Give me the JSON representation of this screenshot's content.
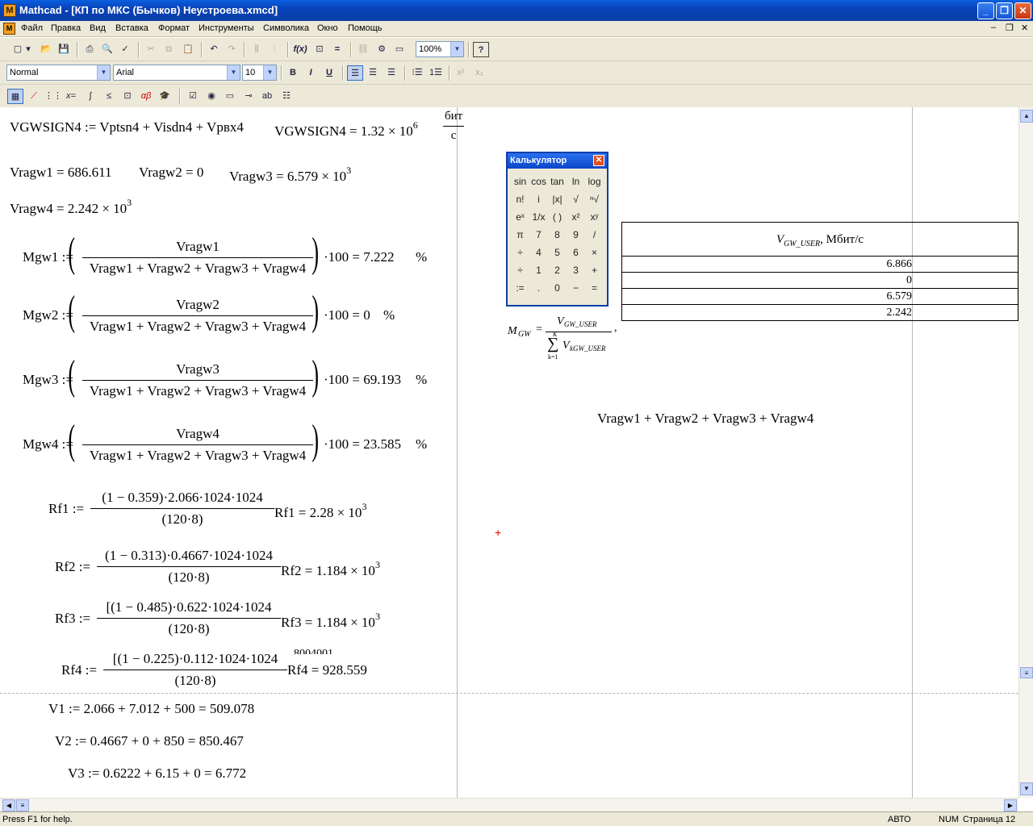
{
  "window": {
    "title": "Mathcad - [КП по МКС (Бычков) Неустроева.xmcd]"
  },
  "menu": [
    "Файл",
    "Правка",
    "Вид",
    "Вставка",
    "Формат",
    "Инструменты",
    "Символика",
    "Окно",
    "Помощь"
  ],
  "format_toolbar": {
    "style": "Normal",
    "font": "Arial",
    "size": "10",
    "zoom": "100%"
  },
  "doc": {
    "vgwsign": {
      "lhs": "VGWSIGN4 := Vptsn4 + Visdn4 + Vрвх4",
      "result": "VGWSIGN4 = 1.32 × 10",
      "exp": "6",
      "unit_num": "бит",
      "unit_den": "с"
    },
    "vrag_line1": {
      "a": "Vragw1 = 686.611",
      "b": "Vragw2 = 0",
      "c": "Vragw3 = 6.579 × 10",
      "c_exp": "3"
    },
    "vrag_line2": {
      "a": "Vragw4 = 2.242 × 10",
      "a_exp": "3"
    },
    "mgw": [
      {
        "lhs": "Mgw1 :=",
        "num": "Vragw1",
        "den": "Vragw1 + Vragw2 + Vragw3 + Vragw4",
        "res": "·100 = 7.222",
        "unit": "%"
      },
      {
        "lhs": "Mgw2 :=",
        "num": "Vragw2",
        "den": "Vragw1 + Vragw2 + Vragw3 + Vragw4",
        "res": "·100 = 0",
        "unit": "%"
      },
      {
        "lhs": "Mgw3 :=",
        "num": "Vragw3",
        "den": "Vragw1 + Vragw2 + Vragw3 + Vragw4",
        "res": "·100 = 69.193",
        "unit": "%"
      },
      {
        "lhs": "Mgw4 :=",
        "num": "Vragw4",
        "den": "Vragw1 + Vragw2 + Vragw3 + Vragw4",
        "res": "·100 = 23.585",
        "unit": "%"
      }
    ],
    "rf": [
      {
        "lhs": "Rf1 :=",
        "num": "(1 − 0.359)·2.066·1024·1024",
        "den": "(120·8)",
        "res": "Rf1 = 2.28 × 10",
        "exp": "3"
      },
      {
        "lhs": "Rf2 :=",
        "num": "(1 − 0.313)·0.4667·1024·1024",
        "den": "(120·8)",
        "res": "Rf2 = 1.184 × 10",
        "exp": "3"
      },
      {
        "lhs": "Rf3 :=",
        "num": "[(1 − 0.485)·0.622·1024·1024",
        "den": "(120·8)",
        "res": "Rf3 = 1.184 × 10",
        "exp": "3"
      },
      {
        "lhs": "Rf4 :=",
        "num": "[(1 − 0.225)·0.112·1024·1024",
        "den": "(120·8)",
        "res": "Rf4 = 928.559",
        "exp": "",
        "tail": ". 8004001"
      }
    ],
    "v": [
      "V1 := 2.066 + 7.012 + 500 = 509.078",
      "V2 := 0.4667 + 0 + 850 = 850.467",
      "V3 := 0.6222 + 6.15 + 0 = 6.772"
    ],
    "sum_expr": "Vragw1 + Vragw2 + Vragw3 + Vragw4",
    "table": {
      "header_v": "V",
      "header_sub": "GW_USER",
      "header_unit": ", Мбит/с",
      "rows": [
        "6.866",
        "0",
        "6.579",
        "2.242"
      ]
    },
    "formula": {
      "m": "M",
      "m_sub": "GW",
      "eq": "=",
      "num_v": "V",
      "num_sub": "GW_USER",
      "sum_top": "K",
      "sum_sym": "∑",
      "sum_bot": "k=1",
      "den_v": "V",
      "den_sub": "kGW_USER",
      "comma": ","
    }
  },
  "calculator": {
    "title": "Калькулятор",
    "keys": [
      "sin",
      "cos",
      "tan",
      "ln",
      "log",
      "n!",
      "i",
      "|x|",
      "√",
      "ⁿ√",
      "eˣ",
      "1/x",
      "( )",
      "x²",
      "xʸ",
      "π",
      "7",
      "8",
      "9",
      "/",
      "÷",
      "4",
      "5",
      "6",
      "×",
      "÷",
      "1",
      "2",
      "3",
      "+",
      ":=",
      ".",
      "0",
      "−",
      "="
    ]
  },
  "status": {
    "help": "Press F1 for help.",
    "mode": "АВТО",
    "num": "NUM",
    "page": "Страница 12"
  }
}
